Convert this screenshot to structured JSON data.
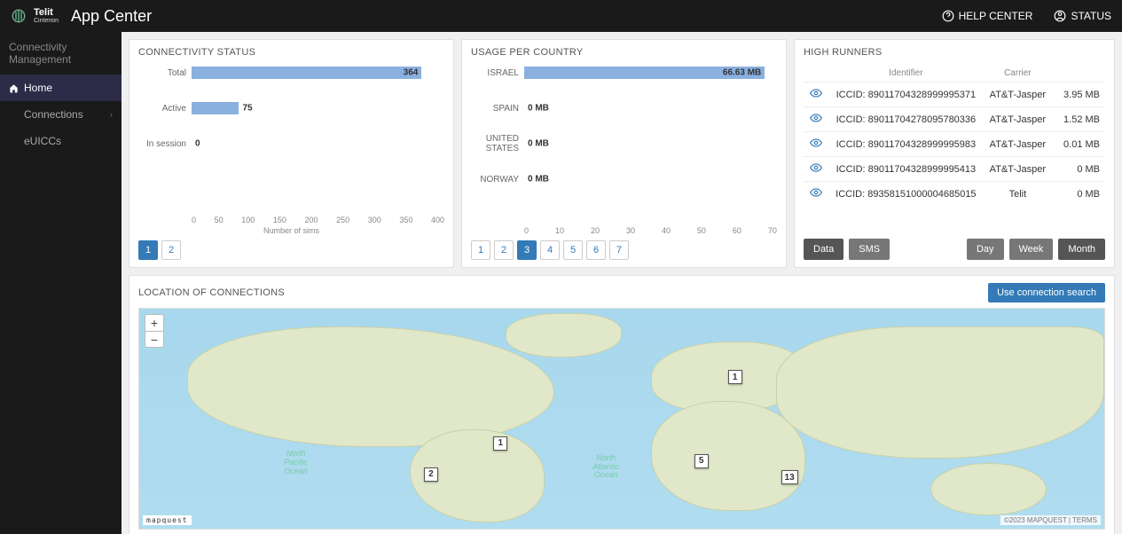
{
  "header": {
    "brand": {
      "line1": "Telit",
      "line2": "Cinterion"
    },
    "app_title": "App Center",
    "help_label": "HELP CENTER",
    "status_label": "STATUS"
  },
  "sidebar": {
    "section": "Connectivity Management",
    "items": [
      {
        "label": "Home",
        "icon": "home-icon",
        "active": true
      },
      {
        "label": "Connections",
        "icon": "chart-icon",
        "expandable": true
      },
      {
        "label": "eUICCs",
        "icon": "list-icon"
      }
    ]
  },
  "panels": {
    "connectivity": {
      "title": "CONNECTIVITY STATUS",
      "xlabel": "Number of sims",
      "pager": {
        "pages": [
          "1",
          "2"
        ],
        "active": "1"
      }
    },
    "usage": {
      "title": "USAGE PER COUNTRY",
      "pager": {
        "pages": [
          "1",
          "2",
          "3",
          "4",
          "5",
          "6",
          "7"
        ],
        "active": "3"
      }
    },
    "high": {
      "title": "HIGH RUNNERS",
      "columns": {
        "id": "Identifier",
        "carrier": "Carrier",
        "usage": ""
      },
      "rows": [
        {
          "id": "ICCID: 89011704328999995371",
          "carrier": "AT&T-Jasper",
          "usage": "3.95 MB"
        },
        {
          "id": "ICCID: 89011704278095780336",
          "carrier": "AT&T-Jasper",
          "usage": "1.52 MB"
        },
        {
          "id": "ICCID: 89011704328999995983",
          "carrier": "AT&T-Jasper",
          "usage": "0.01 MB"
        },
        {
          "id": "ICCID: 89011704328999995413",
          "carrier": "AT&T-Jasper",
          "usage": "0 MB"
        },
        {
          "id": "ICCID: 89358151000004685015",
          "carrier": "Telit",
          "usage": "0 MB"
        }
      ],
      "tabs_left": {
        "data": "Data",
        "sms": "SMS",
        "active": "data"
      },
      "tabs_right": {
        "day": "Day",
        "week": "Week",
        "month": "Month",
        "active": "month"
      }
    },
    "map": {
      "title": "LOCATION OF CONNECTIONS",
      "search_btn": "Use connection search",
      "attrib_left": "mapquest",
      "attrib_right": "©2023 MAPQUEST | TERMS",
      "markers": [
        {
          "count": "1",
          "x": 61.0,
          "y": 28.0
        },
        {
          "count": "1",
          "x": 36.7,
          "y": 58.0
        },
        {
          "count": "2",
          "x": 29.5,
          "y": 72.0
        },
        {
          "count": "5",
          "x": 57.5,
          "y": 66.0
        },
        {
          "count": "13",
          "x": 66.5,
          "y": 73.5
        }
      ],
      "ocean": {
        "npac": "North\nPacific\nOcean",
        "natl": "North\nAtlantic\nOcean"
      }
    }
  },
  "chart_data": [
    {
      "id": "connectivity_status",
      "type": "bar",
      "orientation": "horizontal",
      "categories": [
        "Total",
        "Active",
        "In session"
      ],
      "values": [
        364,
        75,
        0
      ],
      "xlabel": "Number of sims",
      "xlim": [
        0,
        400
      ],
      "xticks": [
        0,
        50,
        100,
        150,
        200,
        250,
        300,
        350,
        400
      ]
    },
    {
      "id": "usage_per_country",
      "type": "bar",
      "orientation": "horizontal",
      "categories": [
        "ISRAEL",
        "SPAIN",
        "UNITED STATES",
        "NORWAY"
      ],
      "values": [
        66.63,
        0,
        0,
        0
      ],
      "value_labels": [
        "66.63 MB",
        "0 MB",
        "0 MB",
        "0 MB"
      ],
      "unit": "MB",
      "xlim": [
        0,
        70
      ],
      "xticks": [
        0,
        10,
        20,
        30,
        40,
        50,
        60,
        70
      ]
    }
  ]
}
